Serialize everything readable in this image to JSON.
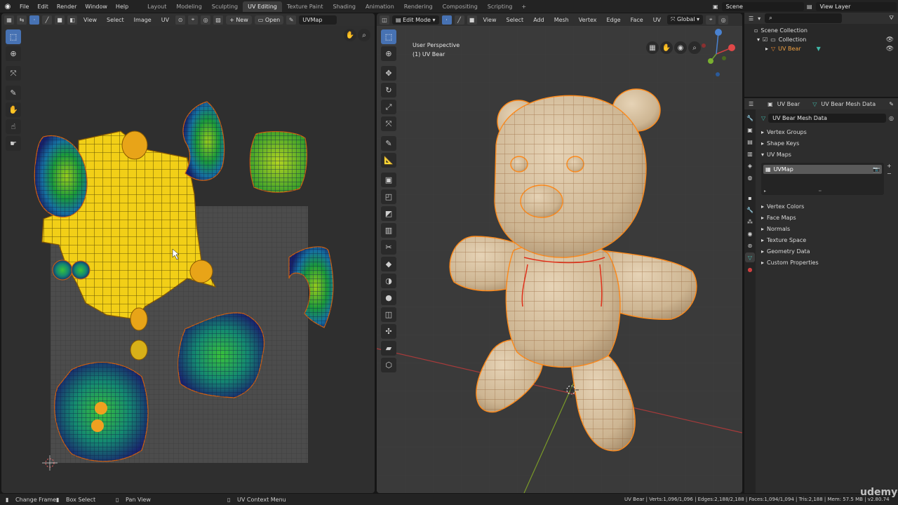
{
  "topbar": {
    "menus": [
      "File",
      "Edit",
      "Render",
      "Window",
      "Help"
    ],
    "tabs": [
      "Layout",
      "Modeling",
      "Sculpting",
      "UV Editing",
      "Texture Paint",
      "Shading",
      "Animation",
      "Rendering",
      "Compositing",
      "Scripting"
    ],
    "active_tab": "UV Editing",
    "add_tab": "+",
    "scene": "Scene",
    "view_layer": "View Layer"
  },
  "uv_editor": {
    "menus": [
      "View",
      "Select",
      "Image",
      "UV"
    ],
    "new_label": "New",
    "open_label": "Open",
    "uvmap_field": "UVMap"
  },
  "viewport": {
    "mode": "Edit Mode",
    "menus": [
      "View",
      "Select",
      "Add",
      "Mesh",
      "Vertex",
      "Edge",
      "Face",
      "UV"
    ],
    "orientation": "Global",
    "perspective": "User Perspective",
    "object_label": "(1) UV Bear"
  },
  "outliner": {
    "root": "Scene Collection",
    "collection": "Collection",
    "object": "UV Bear"
  },
  "properties": {
    "breadcrumb_object": "UV Bear",
    "breadcrumb_data": "UV Bear Mesh Data",
    "mesh_name": "UV Bear Mesh Data",
    "panels_top": [
      "Vertex Groups",
      "Shape Keys",
      "UV Maps"
    ],
    "uv_map_item": "UVMap",
    "panels_bottom": [
      "Vertex Colors",
      "Face Maps",
      "Normals",
      "Texture Space",
      "Geometry Data",
      "Custom Properties"
    ]
  },
  "statusbar": {
    "change_frame": "Change Frame",
    "box_select": "Box Select",
    "pan_view": "Pan View",
    "context_menu": "UV Context Menu",
    "stats": "UV Bear | Verts:1,096/1,096 | Edges:2,188/2,188 | Faces:1,094/1,094 | Tris:2,188 | Mem: 57.5 MB | v2.80.74"
  },
  "watermark": "udemy",
  "colors": {
    "accent": "#4772b3",
    "vertex_orange": "#ff8a1a",
    "bear_skin": "#d8c3a4",
    "uv_yellow": "#f2d21a",
    "axis_red": "#b03434",
    "axis_green": "#7a9a28"
  }
}
